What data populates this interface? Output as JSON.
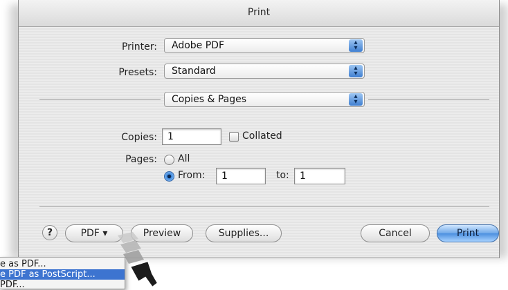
{
  "window": {
    "title": "Print"
  },
  "printer": {
    "label": "Printer:",
    "value": "Adobe PDF"
  },
  "presets": {
    "label": "Presets:",
    "value": "Standard"
  },
  "panel": {
    "value": "Copies & Pages"
  },
  "copies": {
    "label": "Copies:",
    "value": "1",
    "collated_label": "Collated"
  },
  "pages": {
    "label": "Pages:",
    "all_label": "All",
    "from_label": "From:",
    "from_value": "1",
    "to_label": "to:",
    "to_value": "1",
    "selected": "from"
  },
  "buttons": {
    "help": "?",
    "pdf": "PDF ▾",
    "preview": "Preview",
    "supplies": "Supplies...",
    "cancel": "Cancel",
    "print": "Print"
  },
  "pdf_menu": {
    "items": [
      {
        "label": "e as PDF...",
        "selected": false
      },
      {
        "label": "e PDF as PostScript...",
        "selected": true
      },
      {
        "label": " PDF...",
        "selected": false
      }
    ]
  },
  "colors": {
    "selection": "#3d74d0",
    "default_button": "#4b8fe0"
  }
}
